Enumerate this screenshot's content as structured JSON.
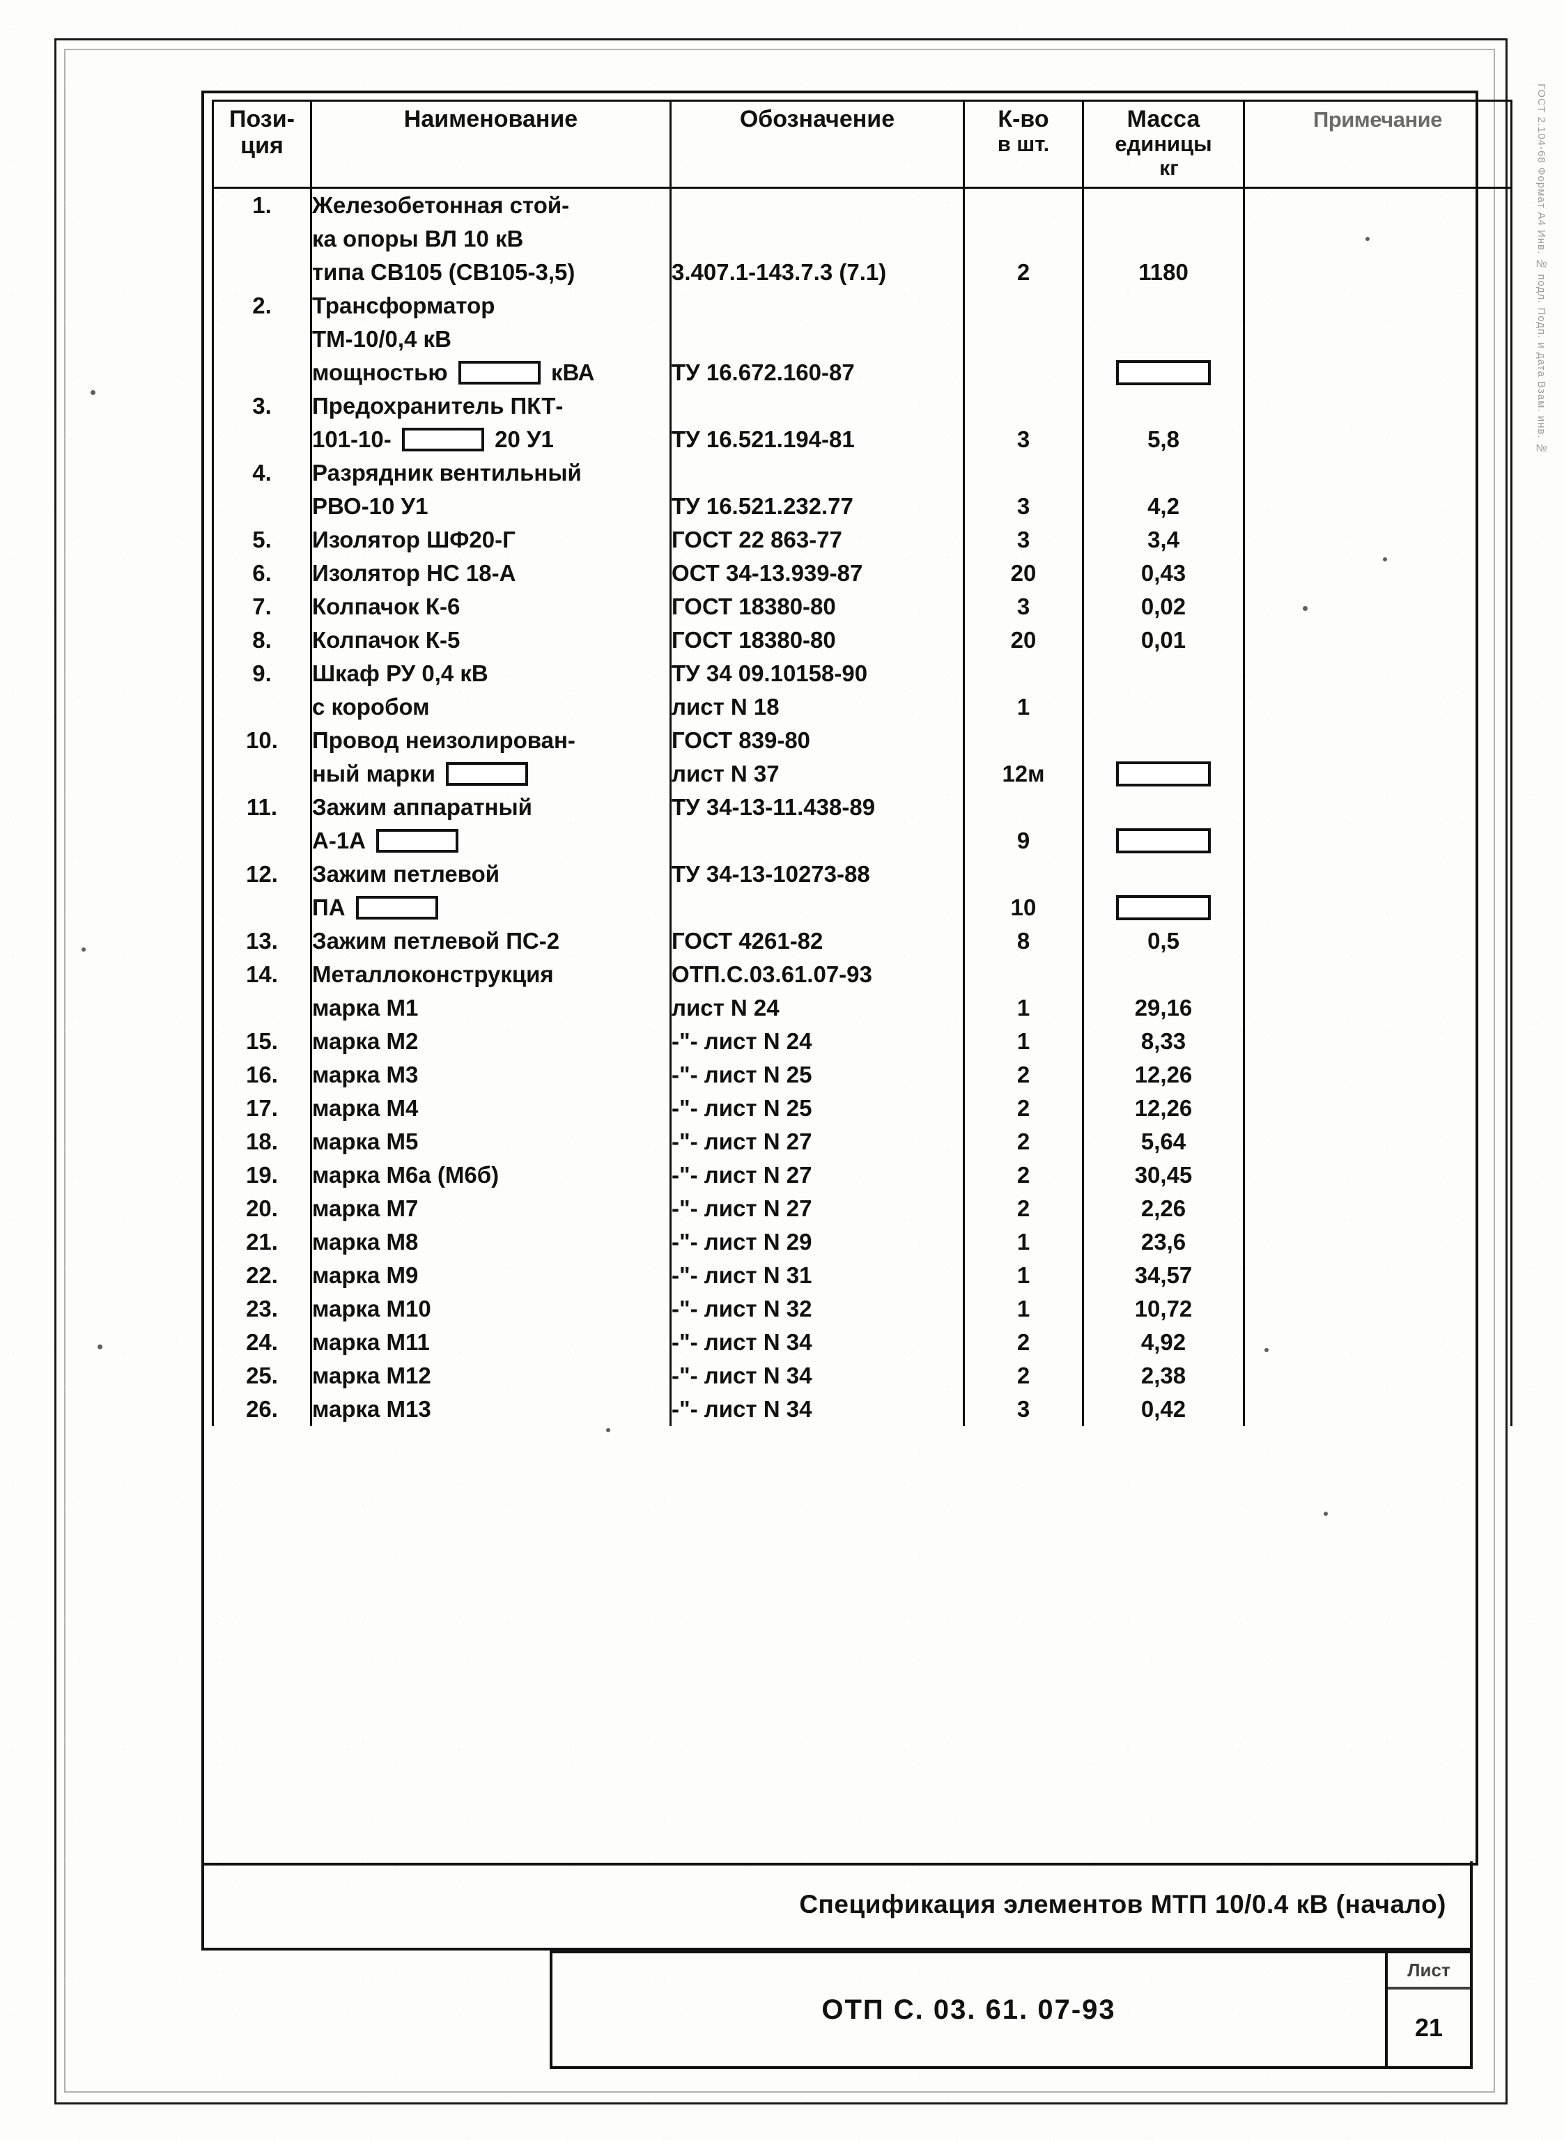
{
  "document": {
    "caption": "Спецификация элементов МТП 10/0.4 кВ   (начало)",
    "stamp_code": "ОТП С. 03. 61. 07-93",
    "sheet_label": "Лист",
    "sheet_number": "21",
    "margin_note": "ГОСТ 2.104-68   Формат А4   Инв. № подл.   Подп. и дата   Взам. инв. №"
  },
  "table": {
    "headers": {
      "position": [
        "Пози-",
        "ция"
      ],
      "name": "Наименование",
      "designation": "Обозначение",
      "quantity": [
        "К-во",
        "в шт."
      ],
      "mass": [
        "Масса",
        "единицы",
        "кг"
      ],
      "note": "Примечание"
    },
    "rows": [
      {
        "pos": "1.",
        "name_lines": [
          "Железобетонная стой-",
          "ка опоры ВЛ 10 кВ",
          "типа СВ105 (СВ105-3,5)"
        ],
        "desig_lines": [
          "",
          "",
          "3.407.1-143.7.3 (7.1)"
        ],
        "qty_lines": [
          "",
          "",
          "2"
        ],
        "mass_lines": [
          "",
          "",
          "1180"
        ],
        "pos_line_index": 0
      },
      {
        "pos": "2.",
        "name_lines": [
          "Трансформатор",
          "ТМ-10/0,4 кВ",
          "мощностью ▭ кВА"
        ],
        "desig_lines": [
          "",
          "",
          "ТУ 16.672.160-87"
        ],
        "qty_lines": [
          "",
          "",
          ""
        ],
        "mass_lines": [
          "",
          "",
          "▭"
        ],
        "pos_line_index": 0,
        "name_box_line": 2,
        "name_box_prefix": "мощностью",
        "name_box_suffix": "кВА",
        "mass_box_line": 2
      },
      {
        "pos": "3.",
        "name_lines": [
          "Предохранитель ПКТ-",
          "101-10- ▭ 20 У1"
        ],
        "desig_lines": [
          "",
          "ТУ 16.521.194-81"
        ],
        "qty_lines": [
          "",
          "3"
        ],
        "mass_lines": [
          "",
          "5,8"
        ],
        "pos_line_index": 0,
        "name_box_line": 1,
        "name_box_prefix": "101-10-",
        "name_box_suffix": "20 У1"
      },
      {
        "pos": "4.",
        "name_lines": [
          "Разрядник вентильный",
          "РВО-10 У1"
        ],
        "desig_lines": [
          "",
          "ТУ 16.521.232.77"
        ],
        "qty_lines": [
          "",
          "3"
        ],
        "mass_lines": [
          "",
          "4,2"
        ],
        "pos_line_index": 0
      },
      {
        "pos": "5.",
        "name_lines": [
          "Изолятор ШФ20-Г"
        ],
        "desig_lines": [
          "ГОСТ 22 863-77"
        ],
        "qty_lines": [
          "3"
        ],
        "mass_lines": [
          "3,4"
        ],
        "pos_line_index": 0
      },
      {
        "pos": "6.",
        "name_lines": [
          "Изолятор НС 18-А"
        ],
        "desig_lines": [
          "ОСТ 34-13.939-87"
        ],
        "qty_lines": [
          "20"
        ],
        "mass_lines": [
          "0,43"
        ],
        "pos_line_index": 0
      },
      {
        "pos": "7.",
        "name_lines": [
          "Колпачок К-6"
        ],
        "desig_lines": [
          "ГОСТ 18380-80"
        ],
        "qty_lines": [
          "3"
        ],
        "mass_lines": [
          "0,02"
        ],
        "pos_line_index": 0
      },
      {
        "pos": "8.",
        "name_lines": [
          "Колпачок К-5"
        ],
        "desig_lines": [
          "ГОСТ 18380-80"
        ],
        "qty_lines": [
          "20"
        ],
        "mass_lines": [
          "0,01"
        ],
        "pos_line_index": 0
      },
      {
        "pos": "9.",
        "name_lines": [
          "Шкаф РУ 0,4 кВ",
          "с коробом"
        ],
        "desig_lines": [
          "ТУ 34 09.10158-90",
          "лист N 18"
        ],
        "qty_lines": [
          "",
          "1"
        ],
        "mass_lines": [
          "",
          ""
        ],
        "pos_line_index": 0
      },
      {
        "pos": "10.",
        "name_lines": [
          "Провод неизолирован-",
          "ный марки ▭"
        ],
        "desig_lines": [
          "ГОСТ 839-80",
          "лист N 37"
        ],
        "qty_lines": [
          "",
          "12м"
        ],
        "mass_lines": [
          "",
          "▭"
        ],
        "pos_line_index": 0,
        "name_box_line": 1,
        "name_box_prefix": "ный марки",
        "name_box_suffix": "",
        "mass_box_line": 1
      },
      {
        "pos": "11.",
        "name_lines": [
          "Зажим аппаратный",
          "А-1А ▭"
        ],
        "desig_lines": [
          "ТУ 34-13-11.438-89",
          ""
        ],
        "qty_lines": [
          "",
          "9"
        ],
        "mass_lines": [
          "",
          "▭"
        ],
        "pos_line_index": 0,
        "name_box_line": 1,
        "name_box_prefix": "А-1А",
        "name_box_suffix": "",
        "mass_box_line": 1
      },
      {
        "pos": "12.",
        "name_lines": [
          "Зажим петлевой",
          "ПА ▭"
        ],
        "desig_lines": [
          "ТУ 34-13-10273-88",
          ""
        ],
        "qty_lines": [
          "",
          "10"
        ],
        "mass_lines": [
          "",
          "▭"
        ],
        "pos_line_index": 0,
        "name_box_line": 1,
        "name_box_prefix": "ПА",
        "name_box_suffix": "",
        "mass_box_line": 1
      },
      {
        "pos": "13.",
        "name_lines": [
          "Зажим петлевой ПС-2"
        ],
        "desig_lines": [
          "ГОСТ 4261-82"
        ],
        "qty_lines": [
          "8"
        ],
        "mass_lines": [
          "0,5"
        ],
        "pos_line_index": 0
      },
      {
        "pos": "14.",
        "name_lines": [
          "Металлоконструкция",
          "марка М1"
        ],
        "desig_lines": [
          "ОТП.С.03.61.07-93",
          "лист N 24"
        ],
        "qty_lines": [
          "",
          "1"
        ],
        "mass_lines": [
          "",
          "29,16"
        ],
        "pos_line_index": 0
      },
      {
        "pos": "15.",
        "name_lines": [
          "марка М2"
        ],
        "desig_lines": [
          "-\"- лист N 24"
        ],
        "qty_lines": [
          "1"
        ],
        "mass_lines": [
          "8,33"
        ],
        "pos_line_index": 0
      },
      {
        "pos": "16.",
        "name_lines": [
          "марка М3"
        ],
        "desig_lines": [
          "-\"- лист N 25"
        ],
        "qty_lines": [
          "2"
        ],
        "mass_lines": [
          "12,26"
        ],
        "pos_line_index": 0
      },
      {
        "pos": "17.",
        "name_lines": [
          "марка М4"
        ],
        "desig_lines": [
          "-\"- лист N 25"
        ],
        "qty_lines": [
          "2"
        ],
        "mass_lines": [
          "12,26"
        ],
        "pos_line_index": 0
      },
      {
        "pos": "18.",
        "name_lines": [
          "марка М5"
        ],
        "desig_lines": [
          "-\"- лист N 27"
        ],
        "qty_lines": [
          "2"
        ],
        "mass_lines": [
          "5,64"
        ],
        "pos_line_index": 0
      },
      {
        "pos": "19.",
        "name_lines": [
          "марка М6а (М6б)"
        ],
        "desig_lines": [
          "-\"- лист N 27"
        ],
        "qty_lines": [
          "2"
        ],
        "mass_lines": [
          "30,45"
        ],
        "pos_line_index": 0
      },
      {
        "pos": "20.",
        "name_lines": [
          "марка М7"
        ],
        "desig_lines": [
          "-\"- лист N 27"
        ],
        "qty_lines": [
          "2"
        ],
        "mass_lines": [
          "2,26"
        ],
        "pos_line_index": 0
      },
      {
        "pos": "21.",
        "name_lines": [
          "марка М8"
        ],
        "desig_lines": [
          "-\"- лист N 29"
        ],
        "qty_lines": [
          "1"
        ],
        "mass_lines": [
          "23,6"
        ],
        "pos_line_index": 0
      },
      {
        "pos": "22.",
        "name_lines": [
          "марка М9"
        ],
        "desig_lines": [
          "-\"- лист N 31"
        ],
        "qty_lines": [
          "1"
        ],
        "mass_lines": [
          "34,57"
        ],
        "pos_line_index": 0
      },
      {
        "pos": "23.",
        "name_lines": [
          "марка М10"
        ],
        "desig_lines": [
          "-\"- лист N 32"
        ],
        "qty_lines": [
          "1"
        ],
        "mass_lines": [
          "10,72"
        ],
        "pos_line_index": 0
      },
      {
        "pos": "24.",
        "name_lines": [
          "марка М11"
        ],
        "desig_lines": [
          "-\"- лист N 34"
        ],
        "qty_lines": [
          "2"
        ],
        "mass_lines": [
          "4,92"
        ],
        "pos_line_index": 0
      },
      {
        "pos": "25.",
        "name_lines": [
          "марка М12"
        ],
        "desig_lines": [
          "-\"- лист N 34"
        ],
        "qty_lines": [
          "2"
        ],
        "mass_lines": [
          "2,38"
        ],
        "pos_line_index": 0
      },
      {
        "pos": "26.",
        "name_lines": [
          "марка М13"
        ],
        "desig_lines": [
          "-\"- лист N 34"
        ],
        "qty_lines": [
          "3"
        ],
        "mass_lines": [
          "0,42"
        ],
        "pos_line_index": 0
      }
    ]
  }
}
